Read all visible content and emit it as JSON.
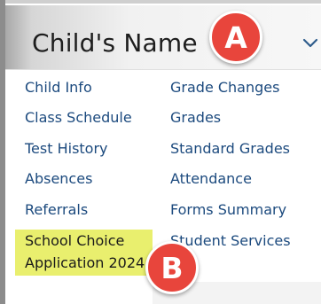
{
  "header": {
    "title": "Child's Name"
  },
  "callouts": {
    "a": "A",
    "b": "B"
  },
  "links": {
    "left": [
      "Child Info",
      "Class Schedule",
      "Test History",
      "Absences",
      "Referrals",
      "School Choice",
      "Application 2024"
    ],
    "right": [
      "Grade Changes",
      "Grades",
      "Standard Grades",
      "Attendance",
      "Forms Summary",
      "Student Services"
    ]
  },
  "colors": {
    "link": "#1c4a7e",
    "callout": "#e8453c",
    "highlight": "#e9ef6e"
  }
}
